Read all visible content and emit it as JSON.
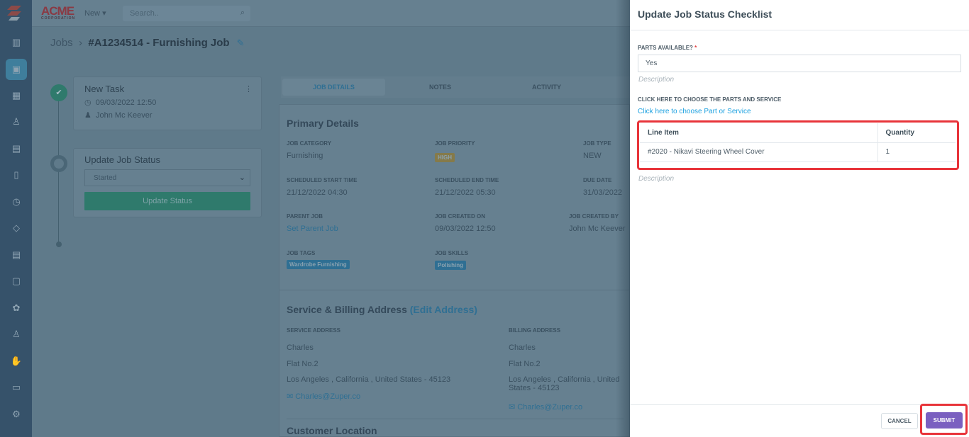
{
  "topbar": {
    "logo": "ACME",
    "logo_sub": "CORPORATION",
    "new_label": "New",
    "search_placeholder": "Search.."
  },
  "breadcrumb": {
    "root": "Jobs",
    "current": "#A1234514 - Furnishing Job"
  },
  "timeline": [
    {
      "title": "New Task",
      "date": "09/03/2022 12:50",
      "user": "John Mc Keever"
    },
    {
      "title": "Update Job Status",
      "status": "Started",
      "button": "Update Status"
    }
  ],
  "tabs": [
    "JOB DETAILS",
    "NOTES",
    "ACTIVITY"
  ],
  "primary": {
    "title": "Primary Details",
    "fields": [
      {
        "label": "Job Category",
        "value": "Furnishing"
      },
      {
        "label": "Job Priority",
        "value": "HIGH"
      },
      {
        "label": "Job Type",
        "value": "NEW"
      },
      {
        "label": "Scheduled Start Time",
        "value": "21/12/2022 04:30"
      },
      {
        "label": "Scheduled End Time",
        "value": "21/12/2022 05:30"
      },
      {
        "label": "Due Date",
        "value": "31/03/2022"
      },
      {
        "label": "Parent Job",
        "value": "Set Parent Job"
      },
      {
        "label": "Job Created On",
        "value": "09/03/2022 12:50"
      },
      {
        "label": "Job Created By",
        "value": "John Mc Keever"
      },
      {
        "label": "Job Tags",
        "value": "Wardrobe Furnishing"
      },
      {
        "label": "Job Skills",
        "value": "Polishing"
      }
    ]
  },
  "address": {
    "title": "Service & Billing Address",
    "edit": "(Edit Address)",
    "service": {
      "label": "Service Address",
      "name": "Charles",
      "line1": "Flat No.2",
      "line2": "Los Angeles , California , United States - 45123",
      "email": "Charles@Zuper.co"
    },
    "billing": {
      "label": "Billing Address",
      "name": "Charles",
      "line1": "Flat No.2",
      "line2": "Los Angeles , California , United States - 45123",
      "email": "Charles@Zuper.co"
    }
  },
  "customer_location": {
    "title": "Customer Location"
  },
  "panel": {
    "title": "Update Job Status Checklist",
    "parts_label": "PARTS AVAILABLE?",
    "required": "*",
    "parts_value": "Yes",
    "description": "Description",
    "choose_label": "CLICK HERE TO CHOOSE THE PARTS AND SERVICE",
    "choose_link": "Click here to choose Part or Service",
    "table": {
      "headers": [
        "Line Item",
        "Quantity"
      ],
      "rows": [
        [
          "#2020 - Nikavi Steering Wheel Cover",
          "1"
        ]
      ]
    },
    "cancel": "CANCEL",
    "submit": "SUBMIT"
  },
  "colors": {
    "accent": "#2d8fb8",
    "submit": "#7a5fc0",
    "highlight": "#e8343a",
    "green": "#2fb59a"
  }
}
